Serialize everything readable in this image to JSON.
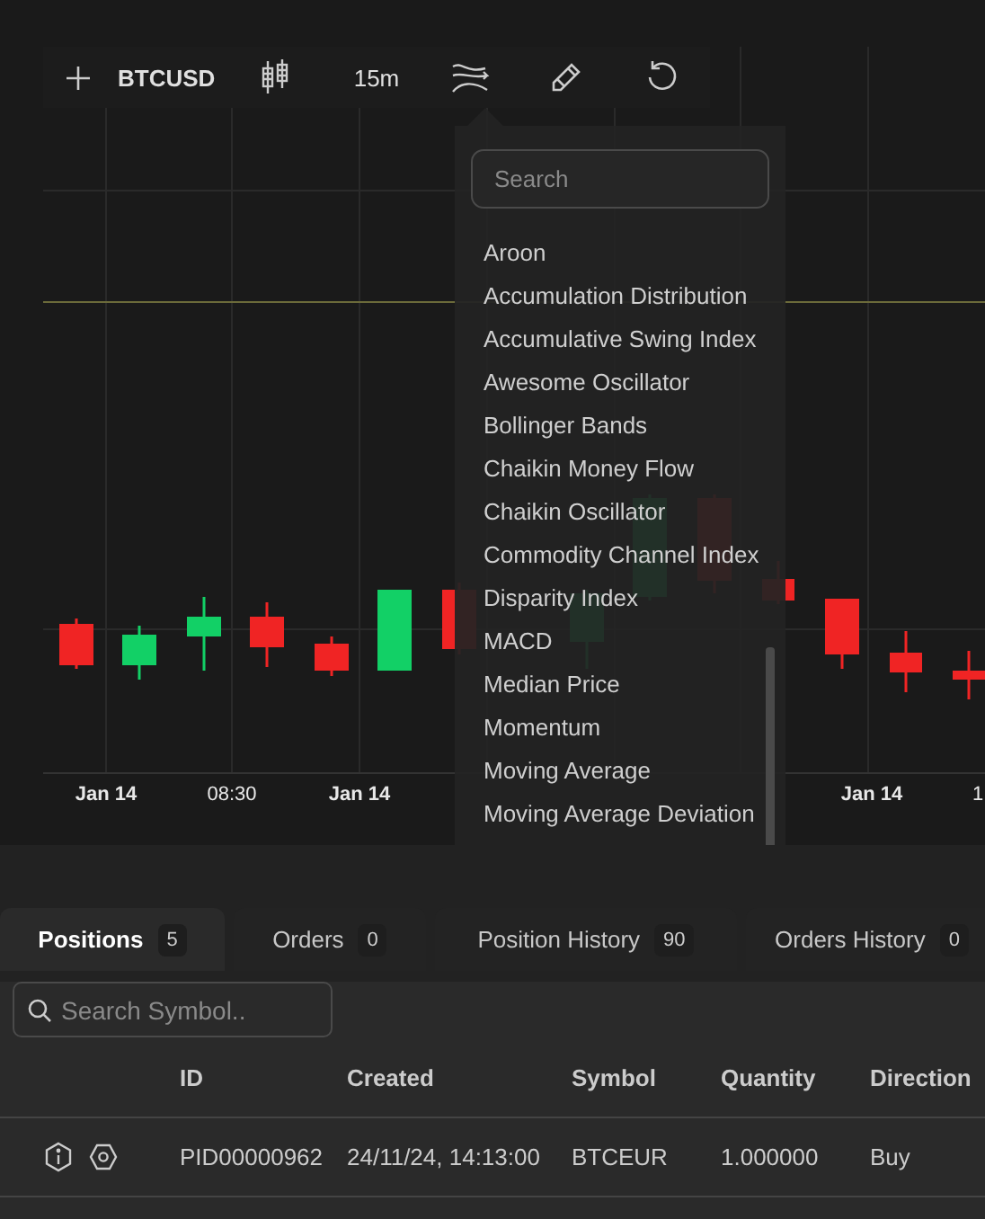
{
  "toolbar": {
    "symbol": "BTCUSD",
    "interval": "15m"
  },
  "chart": {
    "x_labels": [
      {
        "text": "Jan 14",
        "kind": "date"
      },
      {
        "text": "08:30",
        "kind": "time"
      },
      {
        "text": "Jan 14",
        "kind": "date"
      },
      {
        "text": "Jan 14",
        "kind": "date"
      },
      {
        "text": "1",
        "kind": "time"
      }
    ]
  },
  "indicator_menu": {
    "placeholder": "Search",
    "items": [
      "Aroon",
      "Accumulation Distribution",
      "Accumulative Swing Index",
      "Awesome Oscillator",
      "Bollinger Bands",
      "Chaikin Money Flow",
      "Chaikin Oscillator",
      "Commodity Channel Index",
      "Disparity Index",
      "MACD",
      "Median Price",
      "Momentum",
      "Moving Average",
      "Moving Average Deviation"
    ]
  },
  "tabs": [
    {
      "label": "Positions",
      "count": "5",
      "selected": true
    },
    {
      "label": "Orders",
      "count": "0",
      "selected": false
    },
    {
      "label": "Position History",
      "count": "90",
      "selected": false
    },
    {
      "label": "Orders History",
      "count": "0",
      "selected": false
    }
  ],
  "search": {
    "placeholder": "Search Symbol.."
  },
  "table": {
    "columns": [
      "ID",
      "Created",
      "Symbol",
      "Quantity",
      "Direction"
    ],
    "rows": [
      {
        "cells": [
          "PID00000962",
          "24/11/24, 14:13:00",
          "BTCEUR",
          "1.000000",
          "Buy"
        ]
      }
    ]
  }
}
